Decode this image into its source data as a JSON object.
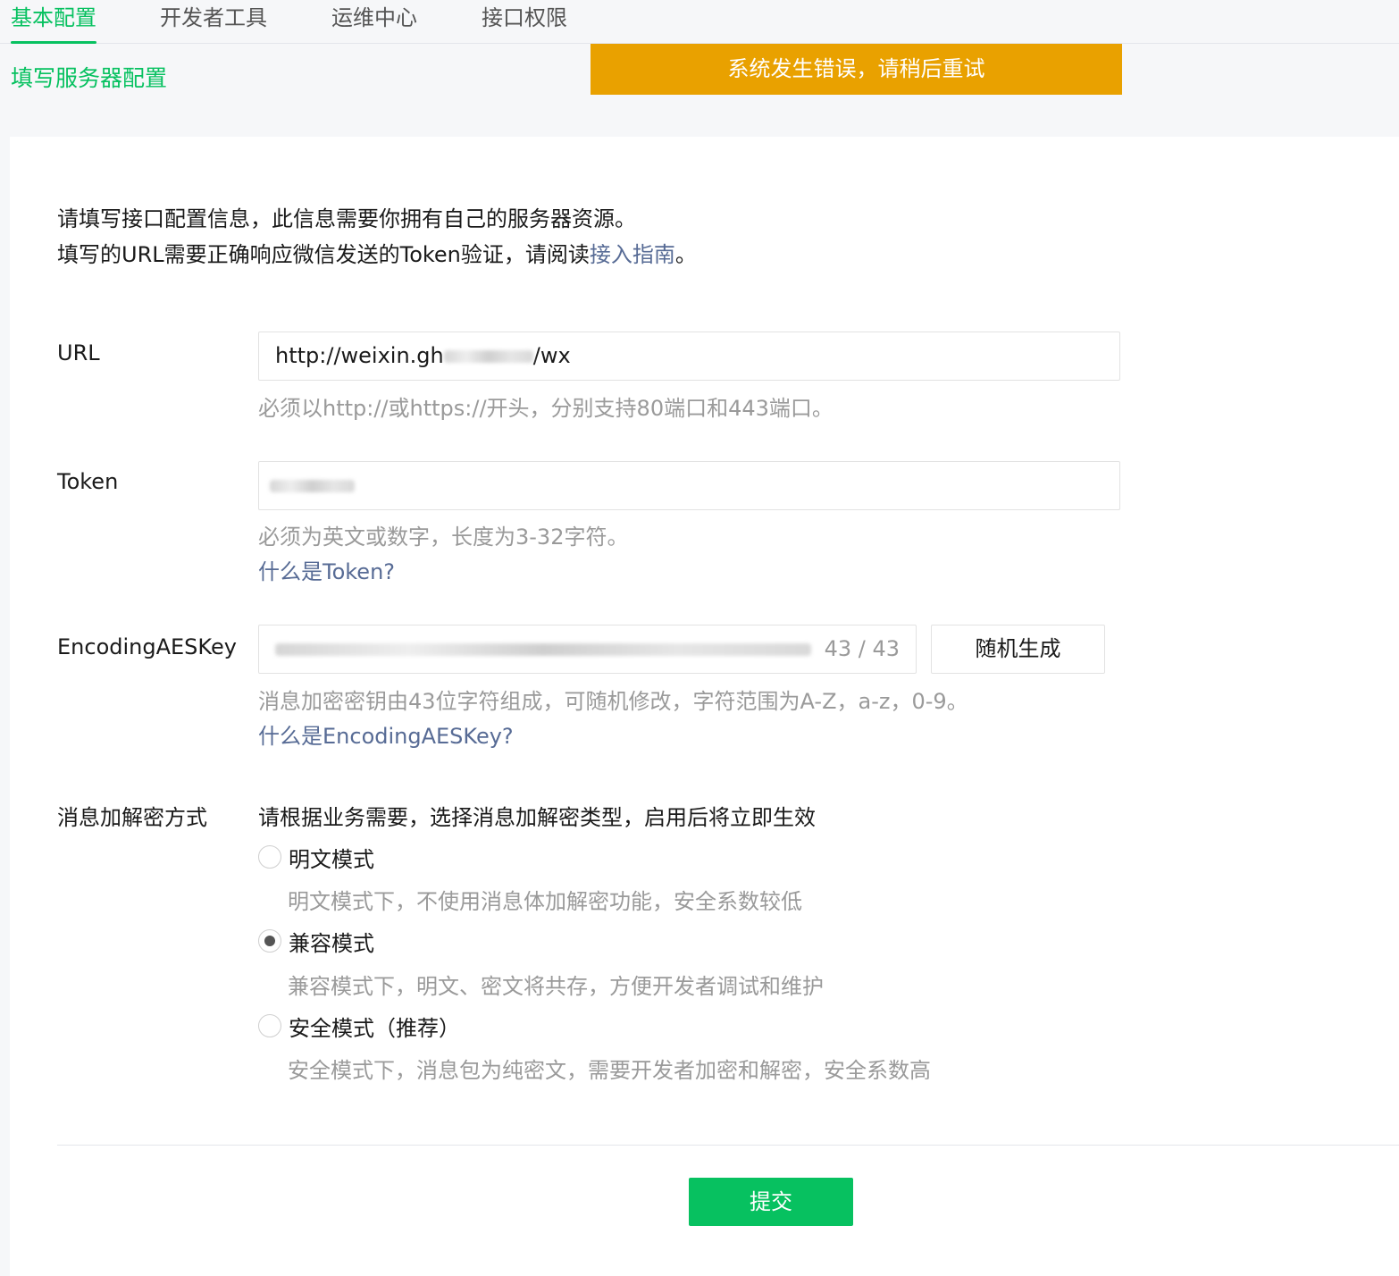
{
  "tabs": [
    {
      "label": "基本配置",
      "active": true
    },
    {
      "label": "开发者工具",
      "active": false
    },
    {
      "label": "运维中心",
      "active": false
    },
    {
      "label": "接口权限",
      "active": false
    }
  ],
  "section_title": "填写服务器配置",
  "toast": "系统发生错误，请稍后重试",
  "intro": {
    "line1": "请填写接口配置信息，此信息需要你拥有自己的服务器资源。",
    "line2_prefix": "填写的URL需要正确响应微信发送的Token验证，请阅读",
    "line2_link": "接入指南",
    "line2_suffix": "。"
  },
  "url": {
    "label": "URL",
    "value_prefix": "http://weixin.gh",
    "value_suffix": "/wx",
    "hint": "必须以http://或https://开头，分别支持80端口和443端口。"
  },
  "token": {
    "label": "Token",
    "hint": "必须为英文或数字，长度为3-32字符。",
    "help": "什么是Token?"
  },
  "aeskey": {
    "label": "EncodingAESKey",
    "counter": "43 / 43",
    "random_button": "随机生成",
    "hint": "消息加密密钥由43位字符组成，可随机修改，字符范围为A-Z，a-z，0-9。",
    "help": "什么是EncodingAESKey?"
  },
  "encryption": {
    "label": "消息加解密方式",
    "description": "请根据业务需要，选择消息加解密类型，启用后将立即生效",
    "options": [
      {
        "label": "明文模式",
        "desc": "明文模式下，不使用消息体加解密功能，安全系数较低",
        "checked": false
      },
      {
        "label": "兼容模式",
        "desc": "兼容模式下，明文、密文将共存，方便开发者调试和维护",
        "checked": true
      },
      {
        "label": "安全模式（推荐）",
        "desc": "安全模式下，消息包为纯密文，需要开发者加密和解密，安全系数高",
        "checked": false
      }
    ]
  },
  "submit": "提交",
  "colors": {
    "accent": "#07c160",
    "toast": "#e9a100",
    "link": "#576b95"
  }
}
